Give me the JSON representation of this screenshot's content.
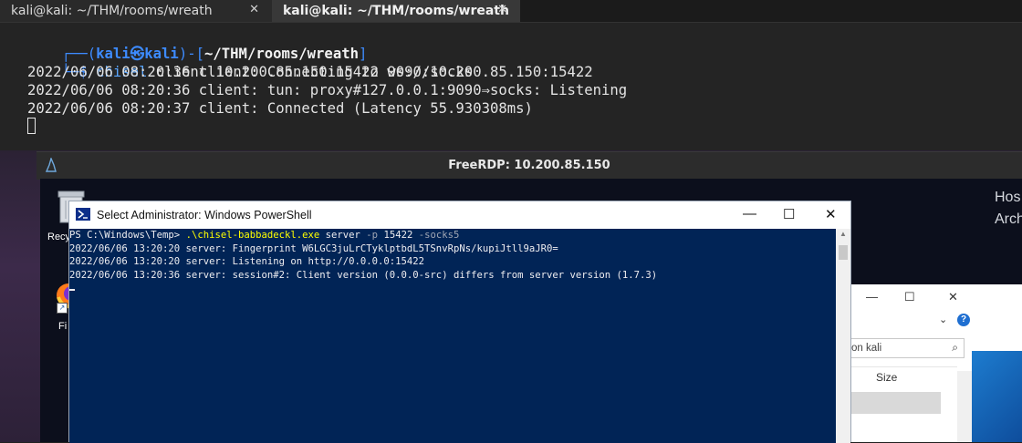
{
  "tabs": [
    {
      "label": "kali@kali: ~/THM/rooms/wreath",
      "active": false
    },
    {
      "label": "kali@kali: ~/THM/rooms/wreath",
      "active": true
    }
  ],
  "terminal": {
    "prompt_open": "┌──(",
    "prompt_user": "kali㉿kali",
    "prompt_mid": ")-[",
    "prompt_path": "~/THM/rooms/wreath",
    "prompt_close": "]",
    "prompt_dollar": "└─$ ",
    "command": "chisel",
    "command_args": " client 10.200.85.150:15422 9090:socks",
    "output": [
      "2022/06/06 08:20:36 client: Connecting to ws://10.200.85.150:15422",
      "2022/06/06 08:20:36 client: tun: proxy#127.0.0.1:9090⇒socks: Listening",
      "2022/06/06 08:20:37 client: Connected (Latency 55.930308ms)"
    ]
  },
  "freerdp": {
    "title": "FreeRDP: 10.200.85.150"
  },
  "desktop": {
    "recycle_label": "Recy",
    "firefox_label": "Fi",
    "side_text_1": "Hos",
    "side_text_2": "Arch"
  },
  "powershell": {
    "title": "Select Administrator: Windows PowerShell",
    "prompt": "PS C:\\Windows\\Temp> ",
    "cmd_exe": ".\\chisel-babbadeckl.exe",
    "cmd_server": " server ",
    "cmd_flag_p": "-p",
    "cmd_port": " 15422 ",
    "cmd_flag_socks": "-socks5",
    "lines": [
      "2022/06/06 13:20:20 server: Fingerprint W6LGC3juLrCTyklptbdL5TSnvRpNs/kupiJtll9aJR0=",
      "2022/06/06 13:20:20 server: Listening on http://0.0.0.0:15422",
      "2022/06/06 13:20:36 server: session#2: Client version (0.0.0-src) differs from server version (1.7.3)"
    ]
  },
  "explorer": {
    "search_placeholder": "on kali",
    "column_size": "Size"
  },
  "colors": {
    "terminal_bg": "#242424",
    "prompt_blue": "#3d8bff",
    "powershell_bg": "#012456",
    "ps_exe_yellow": "#ffff00"
  }
}
